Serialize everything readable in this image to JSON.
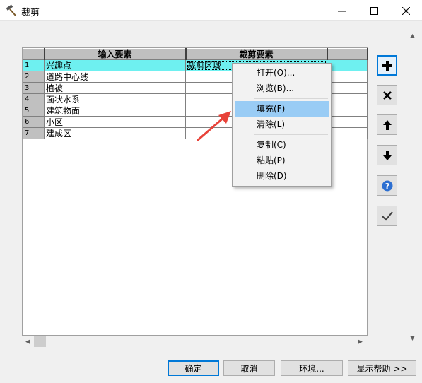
{
  "window": {
    "title": "裁剪",
    "icon": "hammer-icon",
    "controls": [
      "minimize-icon",
      "maximize-icon",
      "close-icon"
    ]
  },
  "grid": {
    "headers": [
      "",
      "输入要素",
      "裁剪要素",
      ""
    ],
    "rows": [
      {
        "num": "1",
        "input": "兴趣点",
        "clip": "裁剪区域",
        "selected": true
      },
      {
        "num": "2",
        "input": "道路中心线",
        "clip": ""
      },
      {
        "num": "3",
        "input": "植被",
        "clip": ""
      },
      {
        "num": "4",
        "input": "面状水系",
        "clip": ""
      },
      {
        "num": "5",
        "input": "建筑物面",
        "clip": ""
      },
      {
        "num": "6",
        "input": "小区",
        "clip": ""
      },
      {
        "num": "7",
        "input": "建成区",
        "clip": ""
      }
    ]
  },
  "context_menu": {
    "items": [
      {
        "label": "打开(O)..."
      },
      {
        "label": "浏览(B)..."
      },
      {
        "label": "填充(F)",
        "highlighted": true
      },
      {
        "label": "清除(L)"
      },
      {
        "label": "复制(C)"
      },
      {
        "label": "粘贴(P)"
      },
      {
        "label": "删除(D)"
      }
    ]
  },
  "side_buttons": [
    "add-icon",
    "delete-icon",
    "move-up-icon",
    "move-down-icon",
    "help-icon",
    "check-icon"
  ],
  "buttons": {
    "ok": "确定",
    "cancel": "取消",
    "environment": "环境...",
    "show_help": "显示帮助 >>"
  },
  "colors": {
    "selected_row": "#6ef0f0",
    "menu_highlight": "#99ccf5",
    "annotation_arrow": "#e8433a",
    "focus_border": "#0078d7"
  }
}
